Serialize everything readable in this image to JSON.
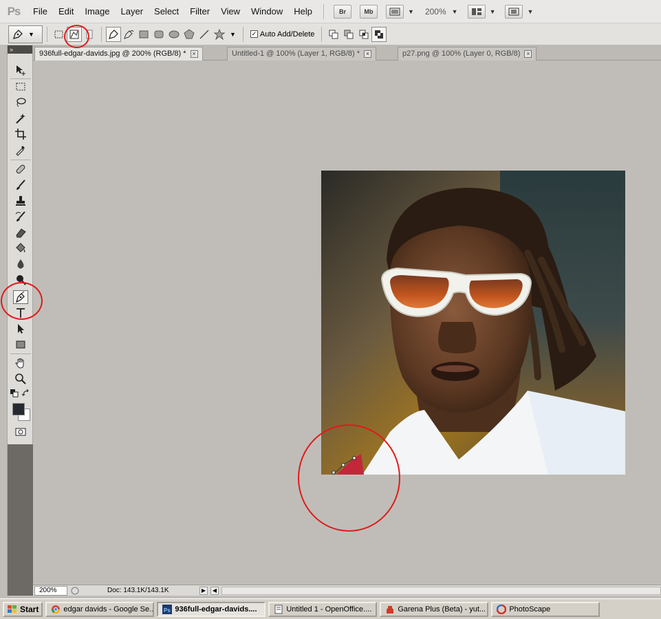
{
  "app": {
    "logo_text": "Ps",
    "menus": [
      "File",
      "Edit",
      "Image",
      "Layer",
      "Select",
      "Filter",
      "View",
      "Window",
      "Help"
    ],
    "bridge_button": "Br",
    "minibridge_button": "Mb",
    "zoom_level": "200%"
  },
  "options_bar": {
    "auto_add_delete_label": "Auto Add/Delete",
    "auto_add_delete_checked": "✓"
  },
  "tabs": [
    {
      "label": "936full-edgar-davids.jpg @ 200% (RGB/8) *",
      "active": true
    },
    {
      "label": "Untitled-1 @ 100% (Layer 1, RGB/8) *",
      "active": false
    },
    {
      "label": "p27.png @ 100% (Layer 0, RGB/8)",
      "active": false
    }
  ],
  "tab_close_glyph": "×",
  "toolbox": {
    "collapse_glyph": "»",
    "foreground_color": "#252a32",
    "background_color": "#ffffff"
  },
  "status": {
    "zoom": "200%",
    "doc_size": "Doc: 143.1K/143.1K",
    "arrow": "▶",
    "left_arrow": "◀"
  },
  "taskbar": {
    "start_label": "Start",
    "items": [
      {
        "label": "edgar davids - Google Se...",
        "icon": "chrome-icon"
      },
      {
        "label": "936full-edgar-davids....",
        "icon": "photoshop-icon"
      },
      {
        "label": "Untitled 1 - OpenOffice....",
        "icon": "openoffice-icon"
      },
      {
        "label": "Garena Plus (Beta) - yut...",
        "icon": "garena-icon"
      },
      {
        "label": "PhotoScape",
        "icon": "photoscape-icon"
      }
    ]
  },
  "annotation_color": "#e01b1b"
}
